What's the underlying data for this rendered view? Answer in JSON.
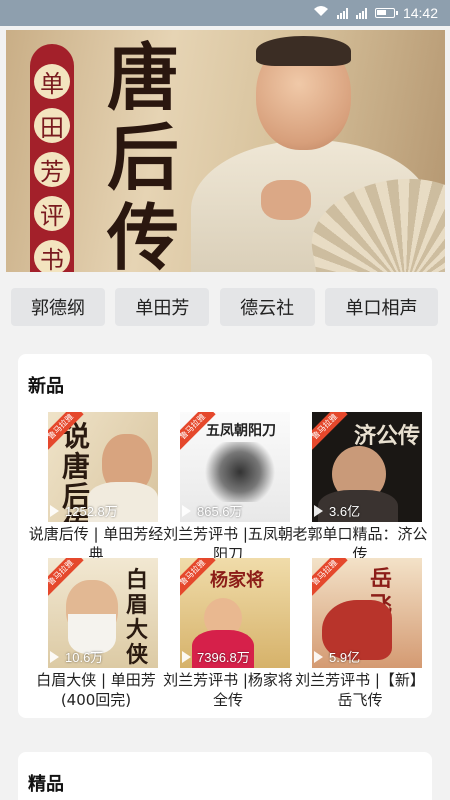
{
  "status_bar": {
    "time": "14:42"
  },
  "banner": {
    "vertical_label": [
      "单",
      "田",
      "芳",
      "评",
      "书"
    ],
    "title_chars": [
      "唐",
      "后",
      "传"
    ]
  },
  "tags": [
    "郭德纲",
    "单田芳",
    "德云社",
    "单口相声"
  ],
  "sections": {
    "new": {
      "title": "新品",
      "items": [
        {
          "title": "说唐后传 | 单田芳经典",
          "plays": "1252.8万",
          "badge": "鲁马拉雅",
          "cover_text": "说唐后传"
        },
        {
          "title": "刘兰芳评书 |五凤朝阳刀",
          "plays": "865.6万",
          "badge": "鲁马拉雅",
          "cover_text": "五凤朝阳刀"
        },
        {
          "title": "老郭单口精品：济公传",
          "plays": "3.6亿",
          "badge": "鲁马拉雅",
          "cover_text": "济公传"
        },
        {
          "title": "白眉大侠 | 单田芳(400回完)",
          "plays": "10.6万",
          "badge": "鲁马拉雅",
          "cover_text": "白眉大侠"
        },
        {
          "title": "刘兰芳评书 |杨家将全传",
          "plays": "7396.8万",
          "badge": "鲁马拉雅",
          "cover_text": "杨家将"
        },
        {
          "title": "刘兰芳评书 |【新】岳飞传",
          "plays": "5.9亿",
          "badge": "鲁马拉雅",
          "cover_text": "岳飞传"
        }
      ]
    },
    "fine": {
      "title": "精品"
    }
  },
  "colors": {
    "status_bar": "#8e9fae",
    "badge": "#e5482c",
    "tag_bg": "#e4e5e7"
  }
}
